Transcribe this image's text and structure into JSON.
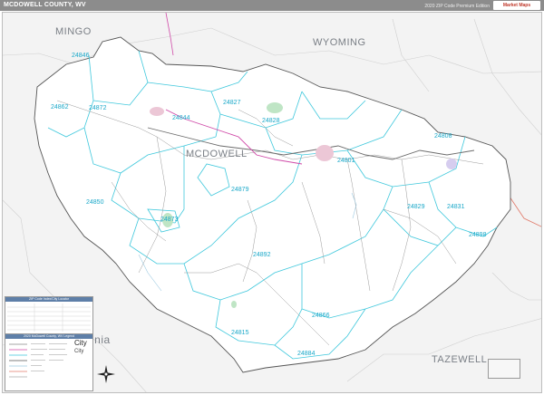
{
  "header": {
    "title": "MCDOWELL COUNTY, WV",
    "edition": "2020 ZIP Code Premium Edition",
    "brand": "Market Maps"
  },
  "regions": {
    "mingo": "MINGO",
    "wyoming": "WYOMING",
    "mcdowell": "MCDOWELL",
    "tazewell": "TAZEWELL",
    "virginia": "inia"
  },
  "zips": [
    {
      "code": "24846"
    },
    {
      "code": "24862"
    },
    {
      "code": "24872"
    },
    {
      "code": "24827"
    },
    {
      "code": "24844"
    },
    {
      "code": "24828"
    },
    {
      "code": "24808"
    },
    {
      "code": "24801"
    },
    {
      "code": "24879"
    },
    {
      "code": "24850"
    },
    {
      "code": "24873"
    },
    {
      "code": "24892"
    },
    {
      "code": "24829"
    },
    {
      "code": "24831"
    },
    {
      "code": "24898"
    },
    {
      "code": "24815"
    },
    {
      "code": "24866"
    },
    {
      "code": "24884"
    }
  ],
  "legend": {
    "zip_header": "ZIP Code Index/City Locator",
    "symbols_header": "2020 McDowell County, WV Legend",
    "city_label": "City"
  },
  "colors": {
    "county_fill": "#ffffff",
    "outside_fill": "#f1f1f1",
    "zip_boundary": "#3fc8dc",
    "county_boundary": "#b04fb0",
    "city_fill": "#e8c4d2",
    "water": "#9ecae1"
  }
}
